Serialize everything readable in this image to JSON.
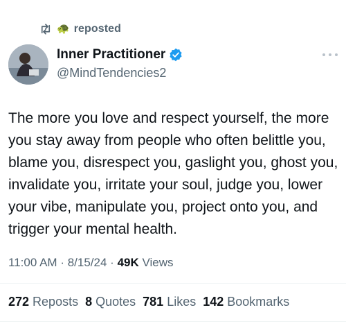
{
  "repost": {
    "label": "reposted",
    "reposter_icon": "turtle-emoji"
  },
  "author": {
    "display_name": "Inner Practitioner",
    "handle": "@MindTendencies2",
    "verified": true,
    "avatar": "avatar-photo"
  },
  "post": {
    "text": "The more you love and respect yourself, the more you stay away from people who often belittle you, blame you, disrespect you, gaslight you, ghost you, invalidate you, irritate your soul, judge you, lower your vibe, manipulate you, project onto you, and trigger your mental health."
  },
  "meta": {
    "time": "11:00 AM",
    "date": "8/15/24",
    "views_count": "49K",
    "views_label": "Views"
  },
  "stats": {
    "reposts": {
      "count": "272",
      "label": "Reposts"
    },
    "quotes": {
      "count": "8",
      "label": "Quotes"
    },
    "likes": {
      "count": "781",
      "label": "Likes"
    },
    "bookmarks": {
      "count": "142",
      "label": "Bookmarks"
    }
  },
  "colors": {
    "text": "#0f1419",
    "muted": "#536471",
    "verified": "#1d9bf0"
  }
}
